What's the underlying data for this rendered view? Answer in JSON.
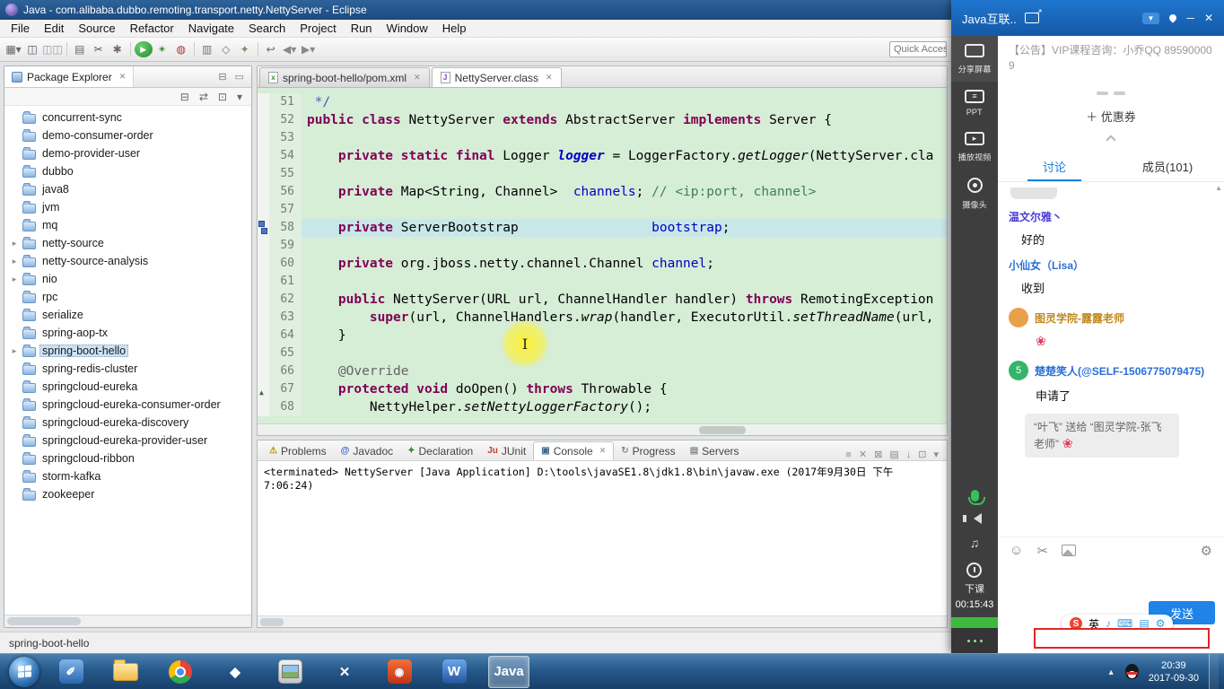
{
  "eclipse": {
    "title_bar": {
      "title": "Java - com.alibaba.dubbo.remoting.transport.netty.NettyServer - Eclipse"
    },
    "menu_bar": {
      "items": [
        "File",
        "Edit",
        "Source",
        "Refactor",
        "Navigate",
        "Search",
        "Project",
        "Run",
        "Window",
        "Help"
      ]
    },
    "toolbar": {
      "quick_access": "Quick Access",
      "icons": [
        "new-wizard",
        "save",
        "save-all",
        "print",
        "scissors",
        "external-tools",
        "run",
        "debug",
        "coverage",
        "new-package",
        "open-type",
        "search",
        "last-edit",
        "back",
        "forward"
      ]
    },
    "package_explorer": {
      "title": "Package Explorer",
      "projects": [
        {
          "label": "concurrent-sync",
          "arrow": false,
          "selected": false
        },
        {
          "label": "demo-consumer-order",
          "arrow": false,
          "selected": false
        },
        {
          "label": "demo-provider-user",
          "arrow": false,
          "selected": false
        },
        {
          "label": "dubbo",
          "arrow": false,
          "selected": false
        },
        {
          "label": "java8",
          "arrow": false,
          "selected": false
        },
        {
          "label": "jvm",
          "arrow": false,
          "selected": false
        },
        {
          "label": "mq",
          "arrow": false,
          "selected": false
        },
        {
          "label": "netty-source",
          "arrow": true,
          "selected": false
        },
        {
          "label": "netty-source-analysis",
          "arrow": true,
          "selected": false
        },
        {
          "label": "nio",
          "arrow": true,
          "selected": false
        },
        {
          "label": "rpc",
          "arrow": false,
          "selected": false
        },
        {
          "label": "serialize",
          "arrow": false,
          "selected": false
        },
        {
          "label": "spring-aop-tx",
          "arrow": false,
          "selected": false
        },
        {
          "label": "spring-boot-hello",
          "arrow": true,
          "selected": true
        },
        {
          "label": "spring-redis-cluster",
          "arrow": false,
          "selected": false
        },
        {
          "label": "springcloud-eureka",
          "arrow": false,
          "selected": false
        },
        {
          "label": "springcloud-eureka-consumer-order",
          "arrow": false,
          "selected": false
        },
        {
          "label": "springcloud-eureka-discovery",
          "arrow": false,
          "selected": false
        },
        {
          "label": "springcloud-eureka-provider-user",
          "arrow": false,
          "selected": false
        },
        {
          "label": "springcloud-ribbon",
          "arrow": false,
          "selected": false
        },
        {
          "label": "storm-kafka",
          "arrow": false,
          "selected": false
        },
        {
          "label": "zookeeper",
          "arrow": false,
          "selected": false
        }
      ]
    },
    "editor": {
      "tabs": [
        {
          "label": "spring-boot-hello/pom.xml",
          "icon": "xml-file",
          "active": false
        },
        {
          "label": "NettyServer.class",
          "icon": "class-file",
          "active": true
        }
      ],
      "lines": [
        {
          "n": "51",
          "m": "",
          "cur": false,
          "seg": [
            [
              "doc",
              " */"
            ]
          ]
        },
        {
          "n": "52",
          "m": "",
          "cur": false,
          "seg": [
            [
              "kw",
              "public class "
            ],
            [
              "pl",
              "NettyServer "
            ],
            [
              "kw",
              "extends "
            ],
            [
              "pl",
              "AbstractServer "
            ],
            [
              "kw",
              "implements "
            ],
            [
              "pl",
              "Server {"
            ]
          ]
        },
        {
          "n": "53",
          "m": "",
          "cur": false,
          "seg": []
        },
        {
          "n": "54",
          "m": "",
          "cur": false,
          "seg": [
            [
              "pl",
              "    "
            ],
            [
              "kw",
              "private static final "
            ],
            [
              "pl",
              "Logger "
            ],
            [
              "sfld",
              "logger"
            ],
            [
              "pl",
              " = LoggerFactory."
            ],
            [
              "sm",
              "getLogger"
            ],
            [
              "pl",
              "(NettyServer.cla"
            ]
          ]
        },
        {
          "n": "55",
          "m": "",
          "cur": false,
          "seg": []
        },
        {
          "n": "56",
          "m": "",
          "cur": false,
          "seg": [
            [
              "pl",
              "    "
            ],
            [
              "kw",
              "private "
            ],
            [
              "pl",
              "Map<String, Channel>  "
            ],
            [
              "fld",
              "channels"
            ],
            [
              "pl",
              "; "
            ],
            [
              "com",
              "// <ip:port, channel>"
            ]
          ]
        },
        {
          "n": "57",
          "m": "",
          "cur": false,
          "seg": []
        },
        {
          "n": "58",
          "m": "occ",
          "cur": true,
          "seg": [
            [
              "pl",
              "    "
            ],
            [
              "kw",
              "private "
            ],
            [
              "pl",
              "ServerBootstrap                 "
            ],
            [
              "fld",
              "bootstrap"
            ],
            [
              "pl",
              ";"
            ]
          ]
        },
        {
          "n": "59",
          "m": "",
          "cur": false,
          "seg": []
        },
        {
          "n": "60",
          "m": "",
          "cur": false,
          "seg": [
            [
              "pl",
              "    "
            ],
            [
              "kw",
              "private "
            ],
            [
              "pl",
              "org.jboss.netty.channel.Channel "
            ],
            [
              "fld",
              "channel"
            ],
            [
              "pl",
              ";"
            ]
          ]
        },
        {
          "n": "61",
          "m": "",
          "cur": false,
          "seg": []
        },
        {
          "n": "62",
          "m": "",
          "cur": false,
          "seg": [
            [
              "pl",
              "    "
            ],
            [
              "kw",
              "public "
            ],
            [
              "pl",
              "NettyServer(URL url, ChannelHandler handler) "
            ],
            [
              "kw",
              "throws "
            ],
            [
              "pl",
              "RemotingException"
            ]
          ]
        },
        {
          "n": "63",
          "m": "",
          "cur": false,
          "seg": [
            [
              "pl",
              "        "
            ],
            [
              "kw",
              "super"
            ],
            [
              "pl",
              "(url, ChannelHandlers."
            ],
            [
              "sm",
              "wrap"
            ],
            [
              "pl",
              "(handler, ExecutorUtil."
            ],
            [
              "sm",
              "setThreadName"
            ],
            [
              "pl",
              "(url,"
            ]
          ]
        },
        {
          "n": "64",
          "m": "",
          "cur": false,
          "seg": [
            [
              "pl",
              "    }"
            ]
          ]
        },
        {
          "n": "65",
          "m": "",
          "cur": false,
          "seg": []
        },
        {
          "n": "66",
          "m": "",
          "cur": false,
          "seg": [
            [
              "pl",
              "    "
            ],
            [
              "ann",
              "@Override"
            ]
          ]
        },
        {
          "n": "67",
          "m": "ovr",
          "cur": false,
          "seg": [
            [
              "pl",
              "    "
            ],
            [
              "kw",
              "protected void "
            ],
            [
              "pl",
              "doOpen() "
            ],
            [
              "kw",
              "throws "
            ],
            [
              "pl",
              "Throwable {"
            ]
          ]
        },
        {
          "n": "68",
          "m": "",
          "cur": false,
          "seg": [
            [
              "pl",
              "        NettyHelper."
            ],
            [
              "sm",
              "setNettyLoggerFactory"
            ],
            [
              "pl",
              "();"
            ]
          ]
        }
      ]
    },
    "console": {
      "tabs": [
        {
          "label": "Problems",
          "icon": "problems",
          "active": false
        },
        {
          "label": "Javadoc",
          "icon": "javadoc",
          "active": false
        },
        {
          "label": "Declaration",
          "icon": "declaration",
          "active": false
        },
        {
          "label": "JUnit",
          "icon": "junit",
          "active": false
        },
        {
          "label": "Console",
          "icon": "console",
          "active": true
        },
        {
          "label": "Progress",
          "icon": "progress",
          "active": false
        },
        {
          "label": "Servers",
          "icon": "servers",
          "active": false
        }
      ],
      "message": "<terminated> NettyServer [Java Application] D:\\tools\\javaSE1.8\\jdk1.8\\bin\\javaw.exe (2017年9月30日 下午7:06:24)"
    },
    "status_bar": {
      "text": "spring-boot-hello"
    }
  },
  "chat": {
    "window_title": "Java互联..",
    "announcement": "【公告】VIP课程咨询：小乔QQ 895900009",
    "coupon": "＋ 优惠券",
    "sidebar": {
      "items": [
        {
          "name": "share-screen",
          "label": "分享屏幕",
          "active": true
        },
        {
          "name": "ppt",
          "label": "PPT",
          "active": false
        },
        {
          "name": "play-video",
          "label": "播放视频",
          "active": false
        },
        {
          "name": "camera",
          "label": "摄像头",
          "active": false
        }
      ],
      "class_end_label": "下课",
      "timer": "00:15:43"
    },
    "tabs": [
      {
        "label": "讨论",
        "active": true
      },
      {
        "label": "成员(101)",
        "active": false
      }
    ],
    "messages": [
      {
        "type": "clipped"
      },
      {
        "type": "plain",
        "name": "温文尔雅丶",
        "name_color": "#4a3bd8",
        "text": "好的"
      },
      {
        "type": "plain",
        "name": "小仙女（Lisa）",
        "name_color": "#2a6fd6",
        "text": "收到"
      },
      {
        "type": "avatar",
        "name": "图灵学院-露露老师",
        "name_color": "#c08a1e",
        "avatar_color": "#e8a04a",
        "avatar_text": "",
        "text": "",
        "rose": true
      },
      {
        "type": "avatar",
        "name": "楚楚笑人(@SELF-1506775079475)",
        "name_color": "#2a6fd6",
        "avatar_color": "#35b56a",
        "avatar_text": "5",
        "text": "申请了",
        "rose": false
      },
      {
        "type": "system",
        "text": "“叶飞” 送给 “图灵学院-张飞老师”",
        "rose": true
      }
    ],
    "send_button": "发送"
  },
  "ime_bar": {
    "lang": "英"
  },
  "taskbar": {
    "icons": [
      {
        "name": "blue-app",
        "active": false
      },
      {
        "name": "folder",
        "active": false
      },
      {
        "name": "chrome",
        "active": false
      },
      {
        "name": "blue-diamond",
        "active": false
      },
      {
        "name": "photos",
        "active": false
      },
      {
        "name": "red-x-app",
        "active": false
      },
      {
        "name": "recorder",
        "active": false
      },
      {
        "name": "word",
        "active": false
      },
      {
        "name": "java-ide",
        "active": true
      }
    ],
    "time": "20:39",
    "date": "2017-09-30"
  }
}
